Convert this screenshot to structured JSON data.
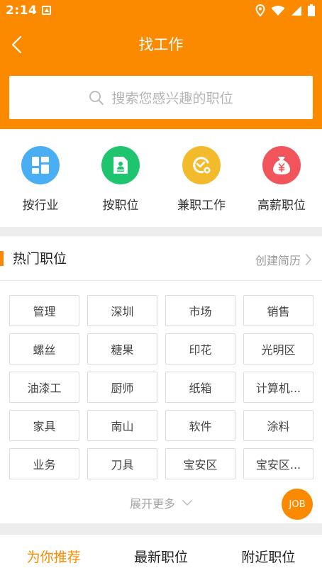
{
  "status_bar": {
    "time": "2:14"
  },
  "header": {
    "title": "找工作",
    "search_placeholder": "搜索您感兴趣的职位"
  },
  "categories": [
    {
      "label": "按行业",
      "icon": "grid-icon",
      "color": "#4aaef5"
    },
    {
      "label": "按职位",
      "icon": "document-icon",
      "color": "#1fc46f"
    },
    {
      "label": "兼职工作",
      "icon": "clock-icon",
      "color": "#f3bb2b"
    },
    {
      "label": "高薪职位",
      "icon": "money-bag-icon",
      "color": "#f2545b"
    }
  ],
  "hot_jobs": {
    "title": "热门职位",
    "create_resume": "创建简历",
    "tags": [
      "管理",
      "深圳",
      "市场",
      "销售",
      "螺丝",
      "糖果",
      "印花",
      "光明区",
      "油漆工",
      "厨师",
      "纸箱",
      "计算机...",
      "家具",
      "南山",
      "软件",
      "涂料",
      "业务",
      "刀具",
      "宝安区",
      "宝安区..."
    ],
    "expand_more": "展开更多"
  },
  "fab": {
    "label": "JOB"
  },
  "tabs": [
    {
      "label": "为你推荐",
      "active": true
    },
    {
      "label": "最新职位",
      "active": false
    },
    {
      "label": "附近职位",
      "active": false
    }
  ],
  "colors": {
    "accent": "#fb8a00"
  }
}
